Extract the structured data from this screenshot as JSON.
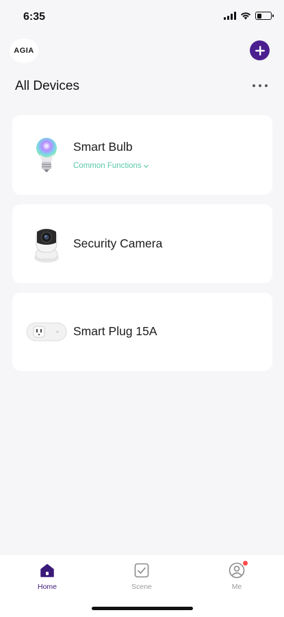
{
  "status_bar": {
    "time": "6:35"
  },
  "header": {
    "logo_text": "AGIA",
    "section_title": "All Devices"
  },
  "devices": [
    {
      "name": "Smart Bulb",
      "quick_link": "Common Functions",
      "icon": "smart-bulb-icon"
    },
    {
      "name": "Security Camera",
      "icon": "security-camera-icon"
    },
    {
      "name": "Smart Plug 15A",
      "icon": "smart-plug-icon"
    }
  ],
  "tab_bar": {
    "tabs": [
      {
        "label": "Home",
        "icon": "home-icon",
        "active": true
      },
      {
        "label": "Scene",
        "icon": "scene-checkbox-icon",
        "active": false
      },
      {
        "label": "Me",
        "icon": "profile-icon",
        "active": false,
        "badge": true
      }
    ]
  },
  "colors": {
    "accent": "#4b1f8f",
    "active_tab": "#3a1a78",
    "link": "#5ac8a8",
    "badge": "#ff4b4b",
    "background": "#f6f6f8"
  }
}
